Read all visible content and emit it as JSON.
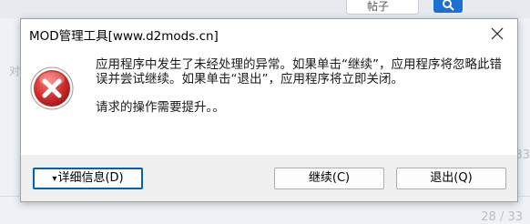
{
  "background": {
    "search_field_text": "帖子",
    "number_right_1": "33",
    "number_right_2": "28 / 33"
  },
  "dialog": {
    "title": "MOD管理工具[www.d2mods.cn]",
    "message_1": "应用程序中发生了未经处理的异常。如果单击“继续”，应用程序将忽略此错误并尝试继续。如果单击“退出”，应用程序将立即关闭。",
    "message_2": "请求的操作需要提升。。",
    "details_label": "详细信息(D)",
    "details_arrow": "▾",
    "continue_label": "继续(C)",
    "exit_label": "退出(Q)"
  },
  "colors": {
    "accent": "#0063b1",
    "error_red": "#d4302f"
  }
}
